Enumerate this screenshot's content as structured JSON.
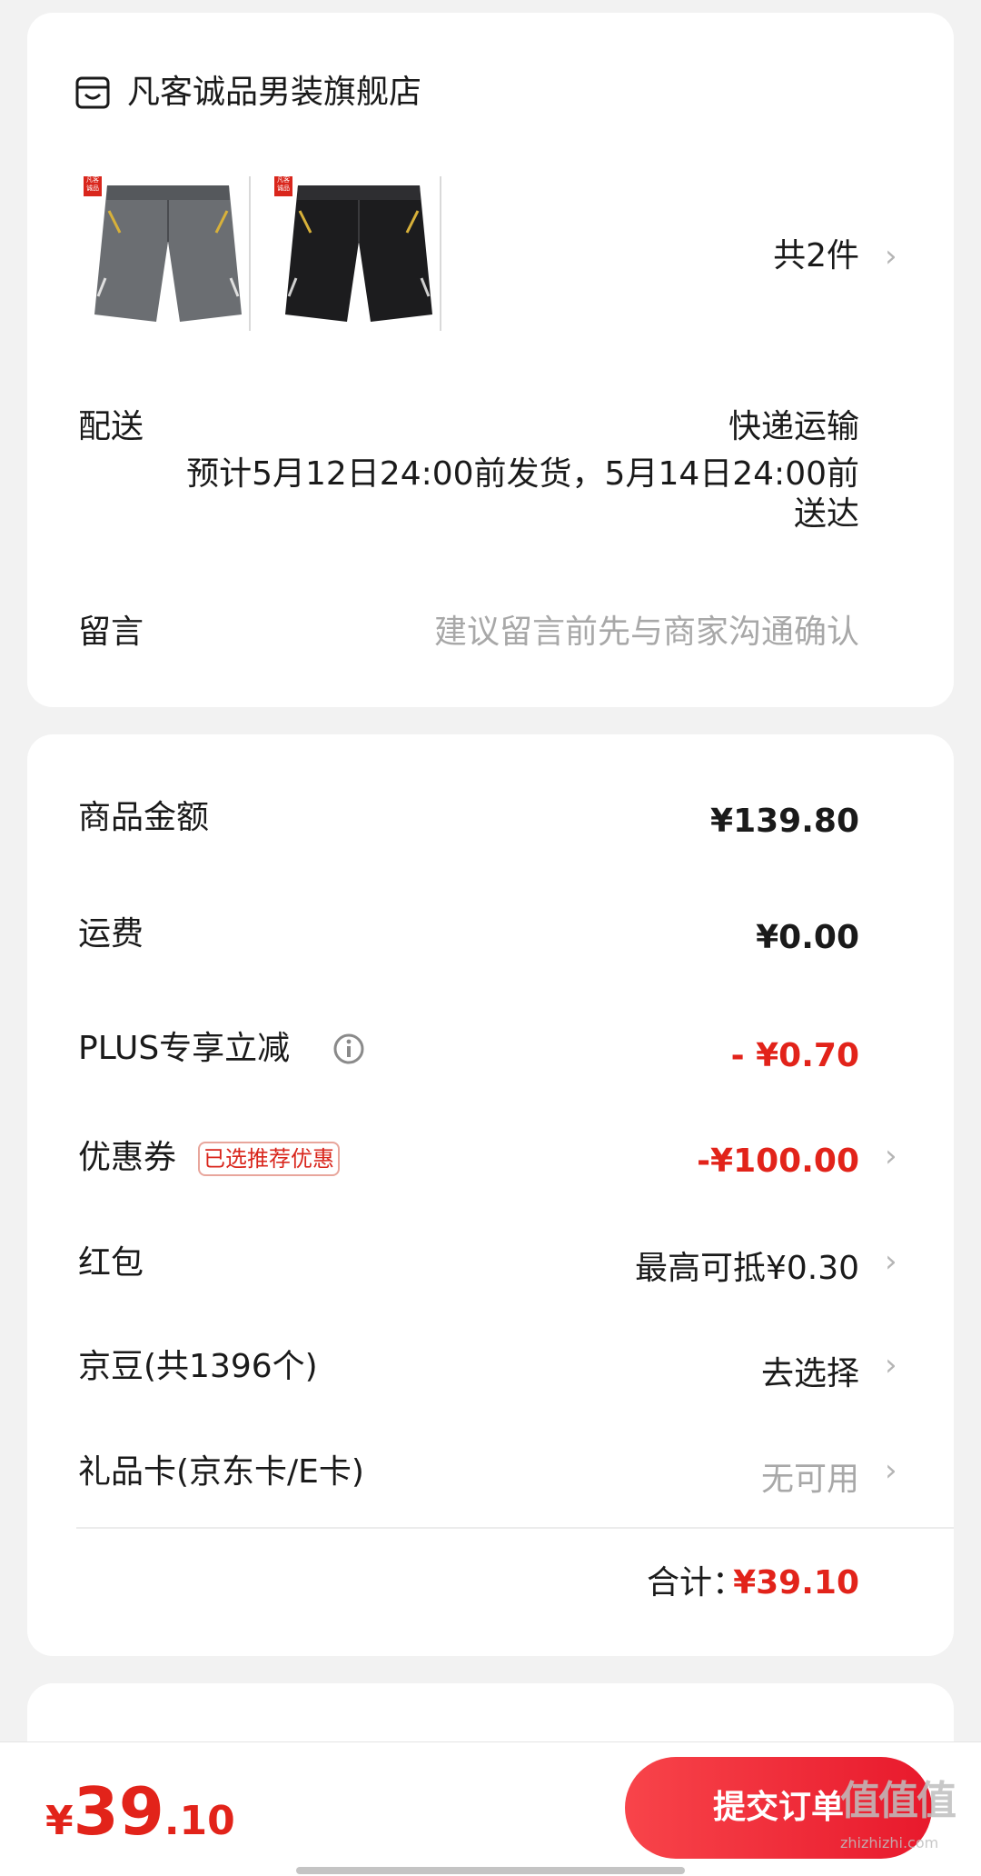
{
  "store": {
    "icon": "store-icon",
    "name": "凡客诚品男装旗舰店",
    "products": [
      {
        "color": "#6b6e72",
        "brand_mark": "凡客诚品"
      },
      {
        "color": "#1c1c1e",
        "brand_mark": "凡客诚品"
      }
    ],
    "count_label": "共2件"
  },
  "delivery": {
    "label": "配送",
    "method": "快递运输",
    "estimate_line1": "预计5月12日24:00前发货，5月14日24:00前",
    "estimate_line2": "送达"
  },
  "message": {
    "label": "留言",
    "placeholder": "建议留言前先与商家沟通确认"
  },
  "price": {
    "goods_label": "商品金额",
    "goods_value": "¥139.80",
    "shipping_label": "运费",
    "shipping_value": "¥0.00",
    "plus_label": "PLUS专享立减",
    "plus_value": "- ¥0.70",
    "coupon_label": "优惠券",
    "coupon_badge": "已选推荐优惠",
    "coupon_value": "-¥100.00",
    "redpacket_label": "红包",
    "redpacket_value": "最高可抵¥0.30",
    "jingdou_label": "京豆(共1396个)",
    "jingdou_value": "去选择",
    "giftcard_label": "礼品卡(京东卡/E卡)",
    "giftcard_value": "无可用",
    "total_label": "合计：",
    "total_value": "¥39.10"
  },
  "footer": {
    "currency": "¥",
    "amount_int": "39",
    "amount_dec": ".10",
    "submit_label": "提交订单"
  },
  "watermark": {
    "text": "值值值",
    "sub": "zhizhizhi.com"
  },
  "colors": {
    "accent_red": "#e2231a",
    "background": "#f2f2f2"
  }
}
